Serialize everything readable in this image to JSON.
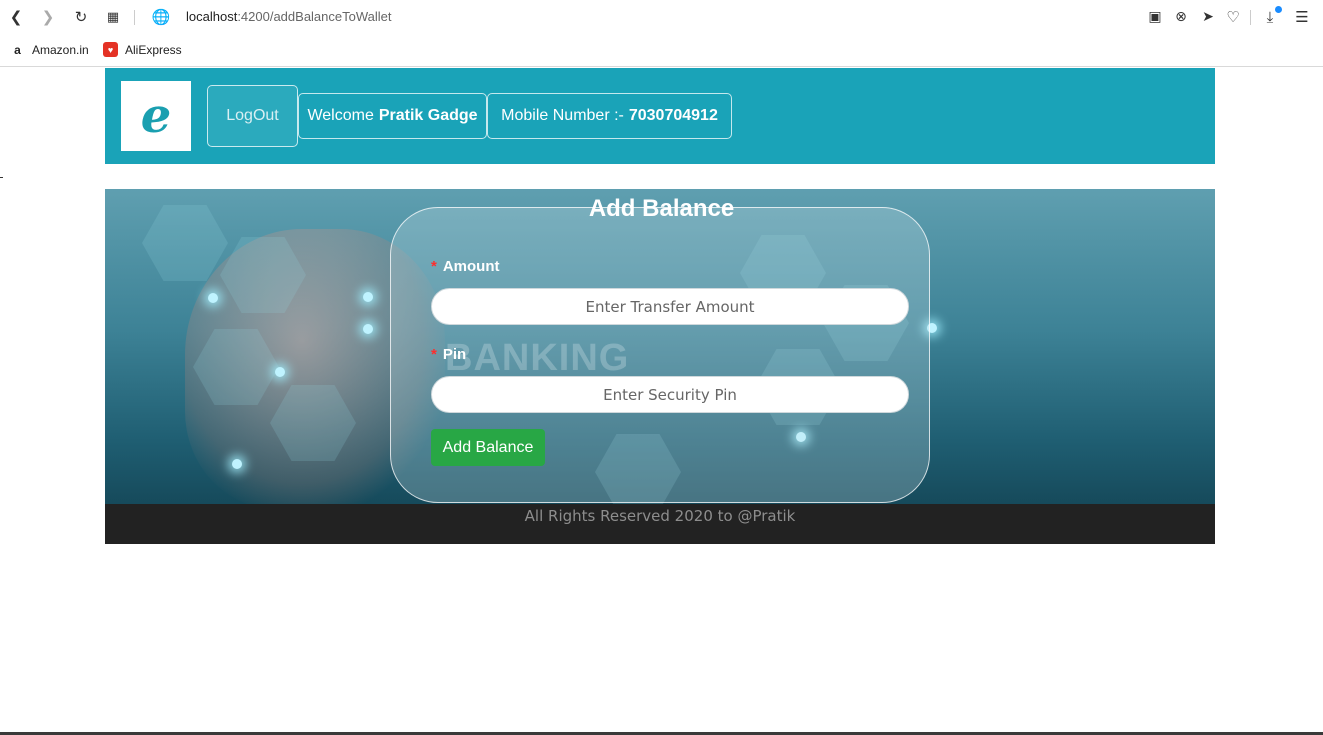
{
  "browser": {
    "url_host": "localhost",
    "url_path": ":4200/addBalanceToWallet",
    "bookmarks": [
      {
        "label": "Amazon.in",
        "icon": "amazon-icon"
      },
      {
        "label": "AliExpress",
        "icon": "aliexpress-icon"
      }
    ]
  },
  "header": {
    "logo_letter": "e",
    "logout_label": "LogOut",
    "welcome_prefix": "Welcome",
    "user_name": "Pratik Gadge",
    "mobile_prefix": "Mobile Number :-",
    "mobile_number": "7030704912"
  },
  "banner": {
    "background_word": "BANKING"
  },
  "form": {
    "title": "Add Balance",
    "amount_label": "Amount",
    "amount_placeholder": "Enter Transfer Amount",
    "pin_label": "Pin",
    "pin_placeholder": "Enter Security Pin",
    "required_mark": "*",
    "submit_label": "Add Balance"
  },
  "footer": {
    "text": "All Rights Reserved 2020 to @Pratik"
  },
  "colors": {
    "header_bg": "#1aa3b8",
    "button_green": "#28a745",
    "footer_bg": "#222222"
  }
}
